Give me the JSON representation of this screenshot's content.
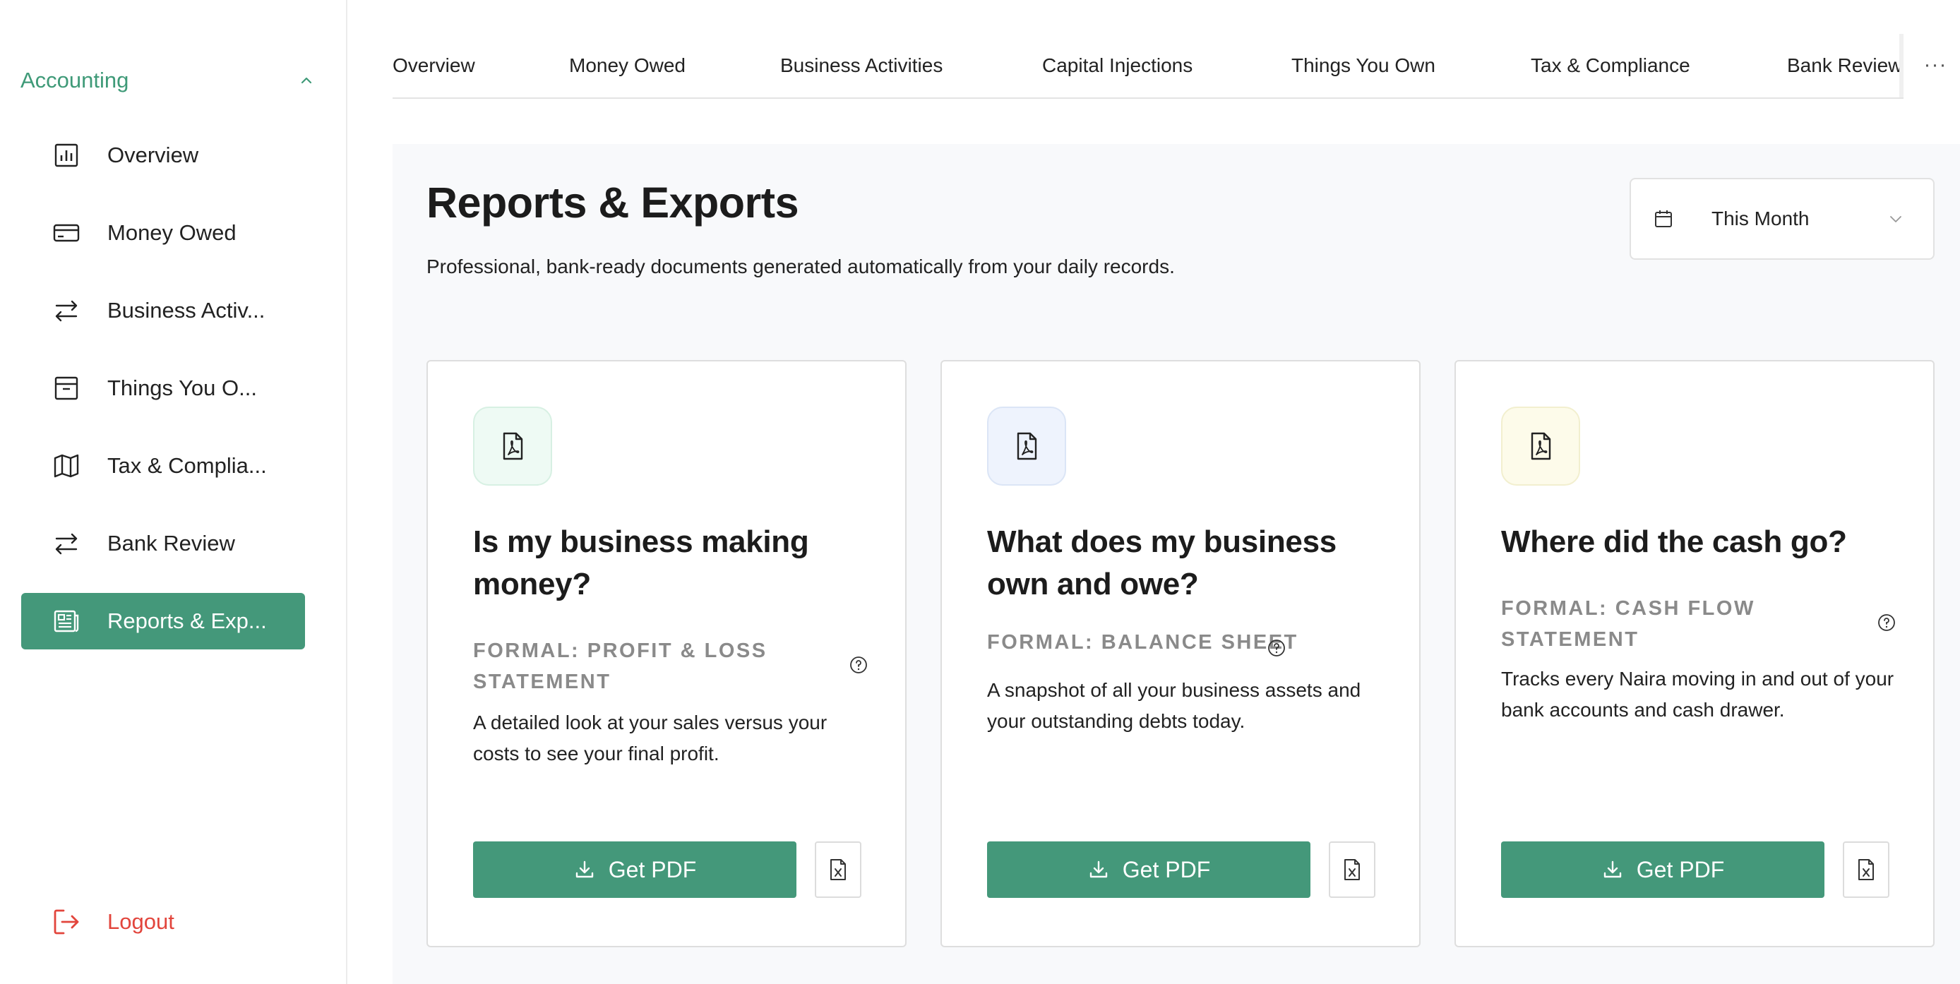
{
  "sidebar": {
    "section_label": "Accounting",
    "items": [
      {
        "label": "Overview",
        "icon": "bar-chart-icon"
      },
      {
        "label": "Money Owed",
        "icon": "credit-card-icon"
      },
      {
        "label": "Business Activ...",
        "icon": "arrows-exchange-icon"
      },
      {
        "label": "Things You O...",
        "icon": "archive-box-icon"
      },
      {
        "label": "Tax & Complia...",
        "icon": "map-icon"
      },
      {
        "label": "Bank Review",
        "icon": "arrows-exchange-icon"
      },
      {
        "label": "Reports & Exp...",
        "icon": "newspaper-icon",
        "active": true
      }
    ],
    "logout_label": "Logout"
  },
  "tabs": [
    {
      "label": "Overview"
    },
    {
      "label": "Money Owed"
    },
    {
      "label": "Business Activities"
    },
    {
      "label": "Capital Injections"
    },
    {
      "label": "Things You Own"
    },
    {
      "label": "Tax & Compliance"
    },
    {
      "label": "Bank Review"
    }
  ],
  "tabs_more_label": "···",
  "page": {
    "title": "Reports & Exports",
    "subtitle": "Professional, bank-ready documents generated automatically from your daily records.",
    "period_value": "This Month"
  },
  "cards": [
    {
      "title": "Is my business making money?",
      "formal": "FORMAL: PROFIT & LOSS STATEMENT",
      "description": "A detailed look at your sales versus your costs to see your final profit.",
      "pdf_label": "Get PDF",
      "badge_color": "#eefaf4"
    },
    {
      "title": "What does my business own and owe?",
      "formal": "FORMAL: BALANCE SHEET",
      "description": "A snapshot of all your business assets and your outstanding debts today.",
      "pdf_label": "Get PDF",
      "badge_color": "#eef3fd"
    },
    {
      "title": "Where did the cash go?",
      "formal": "FORMAL: CASH FLOW STATEMENT",
      "description": "Tracks every Naira moving in and out of your bank accounts and cash drawer.",
      "pdf_label": "Get PDF",
      "badge_color": "#fdfbea"
    }
  ],
  "colors": {
    "brand_green": "#44987a",
    "accent_green_text": "#3f9a78",
    "logout_red": "#e2453c"
  }
}
